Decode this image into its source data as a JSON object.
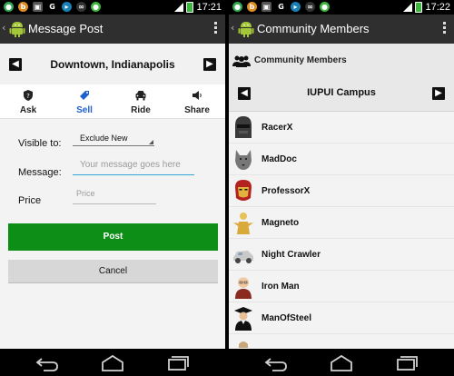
{
  "left": {
    "status": {
      "time": "17:21"
    },
    "actionbar": {
      "title": "Message Post"
    },
    "location": {
      "name": "Downtown, Indianapolis"
    },
    "tabs": [
      {
        "label": "Ask",
        "icon": "shield-icon",
        "selected": false
      },
      {
        "label": "Sell",
        "icon": "tag-icon",
        "selected": true
      },
      {
        "label": "Ride",
        "icon": "car-icon",
        "selected": false
      },
      {
        "label": "Share",
        "icon": "speaker-icon",
        "selected": false
      }
    ],
    "form": {
      "visible_label": "Visible to:",
      "visible_value": "Exclude New",
      "message_label": "Message:",
      "message_placeholder": "Your message goes here",
      "price_label": "Price",
      "price_placeholder": "Price",
      "post_button": "Post",
      "cancel_button": "Cancel"
    },
    "colors": {
      "post_button": "#0d8f17",
      "selected_tab": "#1d5fd0"
    }
  },
  "right": {
    "status": {
      "time": "17:22"
    },
    "actionbar": {
      "title": "Community Members"
    },
    "header_label": "Community Members",
    "campus": "IUPUI Campus",
    "members": [
      {
        "name": "RacerX",
        "avatar": "helmet-avatar"
      },
      {
        "name": "MadDoc",
        "avatar": "wolf-avatar"
      },
      {
        "name": "ProfessorX",
        "avatar": "ironman-avatar"
      },
      {
        "name": "Magneto",
        "avatar": "gold-figure-avatar"
      },
      {
        "name": "Night Crawler",
        "avatar": "car-avatar"
      },
      {
        "name": "Iron Man",
        "avatar": "professor-avatar"
      },
      {
        "name": "ManOfSteel",
        "avatar": "graduate-avatar"
      }
    ]
  }
}
